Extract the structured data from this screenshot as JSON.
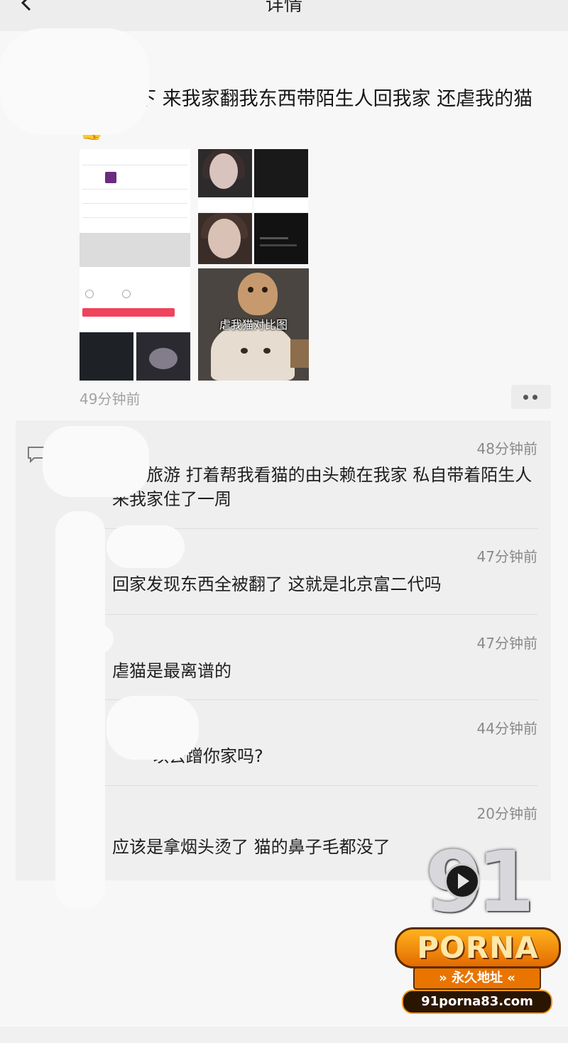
{
  "header": {
    "title": "详情"
  },
  "post": {
    "text": "避雷一下 来我家翻我东西带陌生人回我家 还虐我的猫",
    "emoji": "👍",
    "time": "49分钟前",
    "image_caption": "虐我猫对比图"
  },
  "comments": [
    {
      "time": "48分钟前",
      "text": "我去旅游 打着帮我看猫的由头赖在我家 私自带着陌生人来我家住了一周"
    },
    {
      "time": "47分钟前",
      "text": "回家发现东西全被翻了 这就是北京富二代吗"
    },
    {
      "time": "47分钟前",
      "text": "虐猫是最离谱的"
    },
    {
      "time": "44分钟前",
      "text": "以去蹭你家吗?"
    },
    {
      "time": "20分钟前",
      "text": "应该是拿烟头烫了 猫的鼻子毛都没了"
    }
  ],
  "watermark": {
    "logo_number": "91",
    "brand": "PORNA",
    "ribbon": "» 永久地址 «",
    "url": "91porna83.com"
  },
  "colors": {
    "background": "#f7f7f7",
    "panel": "#efefef",
    "muted_text": "#8a8a8a",
    "watermark_orange": "#e97400"
  }
}
